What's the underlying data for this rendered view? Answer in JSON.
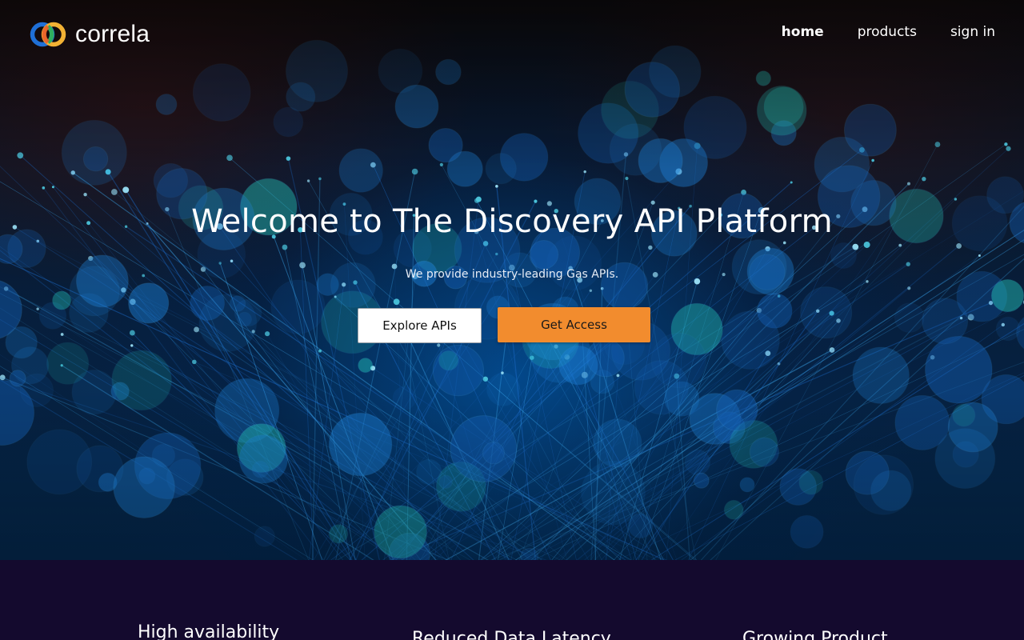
{
  "brand": {
    "name": "correla",
    "logo_colors": [
      "#1f6fd6",
      "#f2b134",
      "#2fae5f",
      "#e85a2a"
    ]
  },
  "nav": {
    "items": [
      {
        "label": "home",
        "active": true
      },
      {
        "label": "products",
        "active": false
      },
      {
        "label": "sign in",
        "active": false
      }
    ]
  },
  "hero": {
    "title": "Welcome to The Discovery API Platform",
    "subtitle": "We provide industry-leading Gas APIs.",
    "explore_label": "Explore APIs",
    "access_label": "Get Access",
    "accent_color": "#f28c2e"
  },
  "features": {
    "items": [
      {
        "title": "High availability"
      },
      {
        "title": "Reduced Data Latency"
      },
      {
        "title": "Growing Product"
      }
    ]
  }
}
